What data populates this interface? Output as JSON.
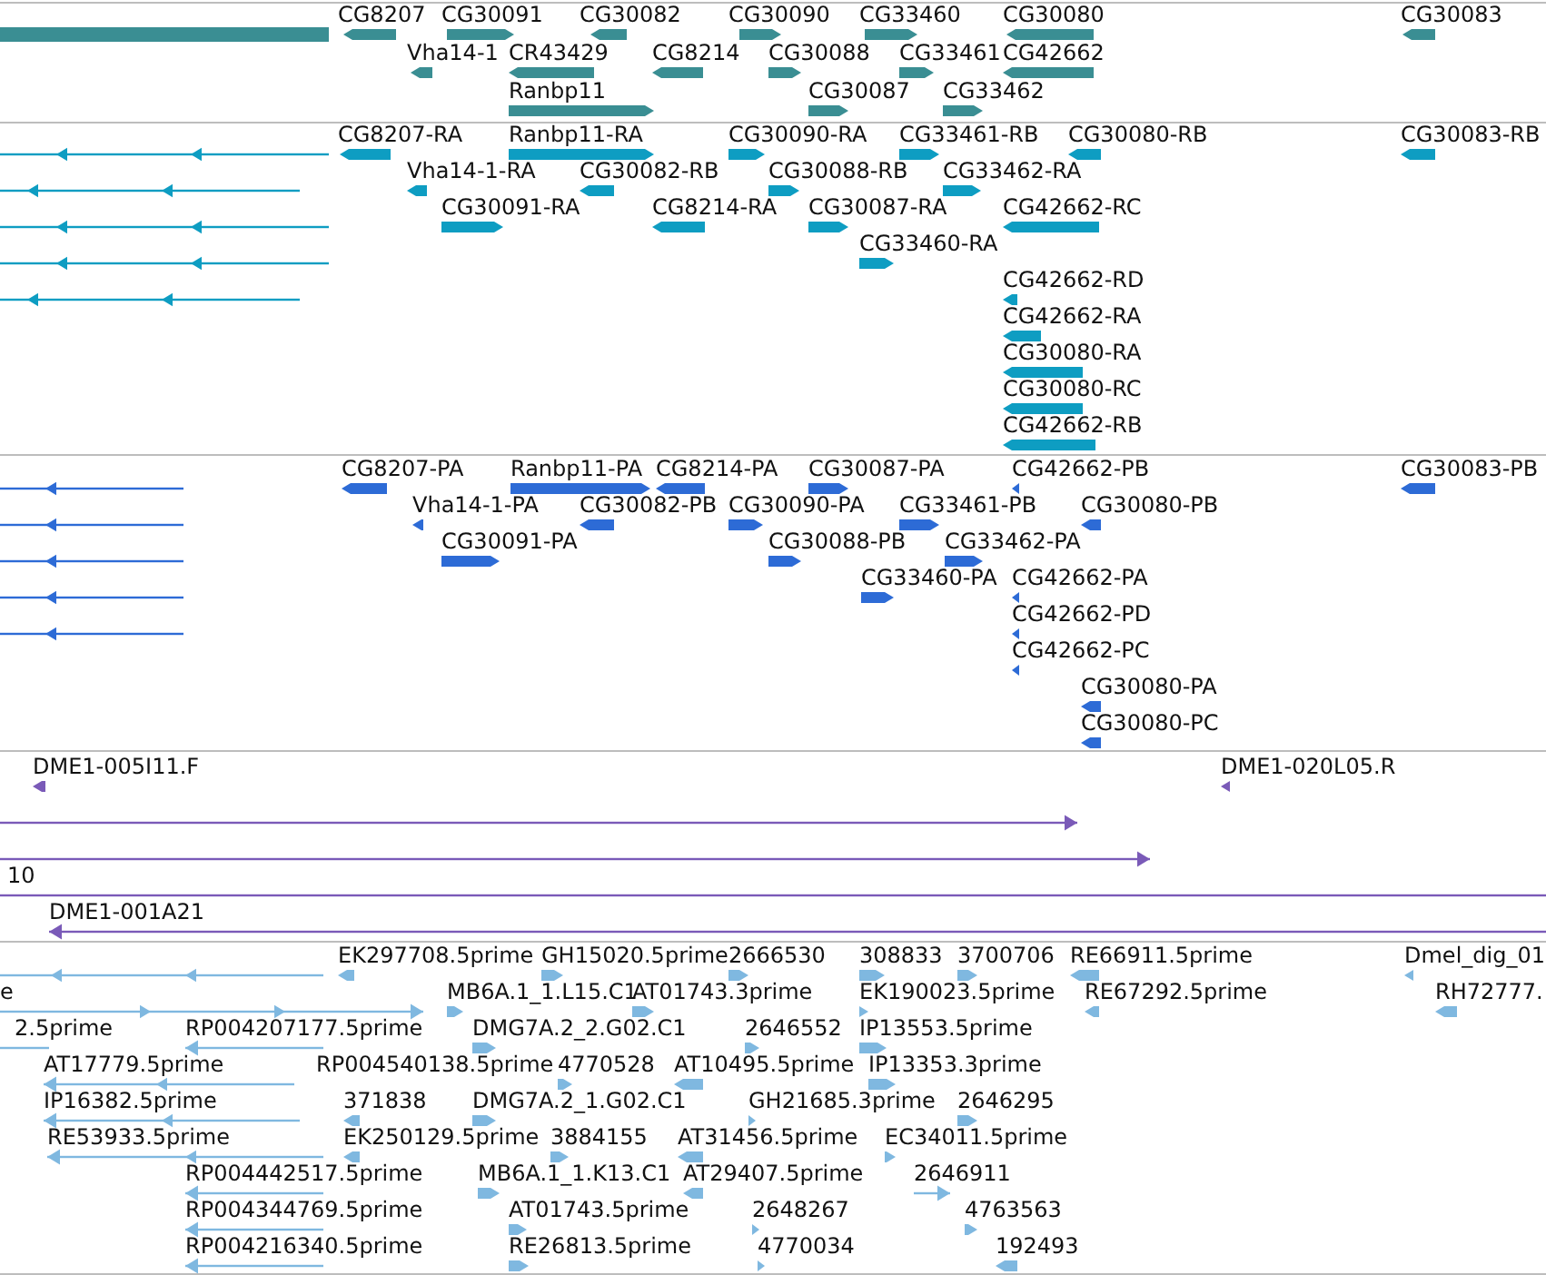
{
  "tracks": [
    {
      "color": "#3a8e93",
      "features": [
        {
          "kind": "block"
        },
        {
          "label": "CG8207",
          "reverse": true,
          "kind": "bar"
        },
        {
          "label": "CG30091",
          "reverse": false,
          "kind": "bar"
        },
        {
          "label": "CG30082",
          "reverse": true,
          "kind": "bar"
        },
        {
          "label": "CG30090",
          "reverse": false,
          "kind": "bar"
        },
        {
          "label": "CG33460",
          "reverse": false,
          "kind": "bar"
        },
        {
          "label": "CG30080",
          "reverse": true,
          "kind": "bar"
        },
        {
          "label": "CG30083",
          "reverse": true,
          "kind": "bar"
        },
        {
          "label": "Vha14-1",
          "reverse": true,
          "kind": "bar"
        },
        {
          "label": "CR43429",
          "reverse": true,
          "kind": "bar"
        },
        {
          "label": "CG8214",
          "reverse": true,
          "kind": "bar"
        },
        {
          "label": "CG30088",
          "reverse": false,
          "kind": "bar"
        },
        {
          "label": "CG33461",
          "reverse": false,
          "kind": "bar"
        },
        {
          "label": "CG42662",
          "reverse": true,
          "kind": "bar"
        },
        {
          "label": "Ranbp11",
          "reverse": false,
          "kind": "bar"
        },
        {
          "label": "CG30087",
          "reverse": false,
          "kind": "bar"
        },
        {
          "label": "CG33462",
          "reverse": false,
          "kind": "bar"
        }
      ]
    },
    {
      "color": "#0e9dc2",
      "features": [
        {
          "reverse": true,
          "kind": "line"
        },
        {
          "reverse": true,
          "kind": "line"
        },
        {
          "reverse": true,
          "kind": "line"
        },
        {
          "reverse": true,
          "kind": "line"
        },
        {
          "reverse": true,
          "kind": "line"
        },
        {
          "label": "CG8207-RA",
          "reverse": true,
          "kind": "bar"
        },
        {
          "label": "Ranbp11-RA",
          "reverse": false,
          "kind": "bar"
        },
        {
          "label": "CG30090-RA",
          "reverse": false,
          "kind": "bar"
        },
        {
          "label": "CG33461-RB",
          "reverse": false,
          "kind": "bar"
        },
        {
          "label": "CG30080-RB",
          "reverse": true,
          "kind": "bar"
        },
        {
          "label": "CG30083-RB",
          "reverse": true,
          "kind": "bar"
        },
        {
          "label": "Vha14-1-RA",
          "reverse": true,
          "kind": "bar"
        },
        {
          "label": "CG30082-RB",
          "reverse": true,
          "kind": "bar"
        },
        {
          "label": "CG30088-RB",
          "reverse": false,
          "kind": "bar"
        },
        {
          "label": "CG33462-RA",
          "reverse": false,
          "kind": "bar"
        },
        {
          "label": "CG30091-RA",
          "reverse": false,
          "kind": "bar"
        },
        {
          "label": "CG8214-RA",
          "reverse": true,
          "kind": "bar"
        },
        {
          "label": "CG30087-RA",
          "reverse": false,
          "kind": "bar"
        },
        {
          "label": "CG42662-RC",
          "reverse": true,
          "kind": "bar"
        },
        {
          "label": "CG33460-RA",
          "reverse": false,
          "kind": "bar"
        },
        {
          "label": "CG42662-RD",
          "reverse": true,
          "kind": "bar"
        },
        {
          "label": "CG42662-RA",
          "reverse": true,
          "kind": "bar"
        },
        {
          "label": "CG30080-RA",
          "reverse": true,
          "kind": "bar"
        },
        {
          "label": "CG30080-RC",
          "reverse": true,
          "kind": "bar"
        },
        {
          "label": "CG42662-RB",
          "reverse": true,
          "kind": "bar"
        }
      ]
    },
    {
      "color": "#2d6bd6",
      "features": [
        {
          "reverse": true,
          "kind": "line"
        },
        {
          "reverse": true,
          "kind": "line"
        },
        {
          "reverse": true,
          "kind": "line"
        },
        {
          "reverse": true,
          "kind": "line"
        },
        {
          "reverse": true,
          "kind": "line"
        },
        {
          "label": "CG8207-PA",
          "reverse": true,
          "kind": "bar"
        },
        {
          "label": "Ranbp11-PA",
          "reverse": false,
          "kind": "bar"
        },
        {
          "label": "CG8214-PA",
          "reverse": true,
          "kind": "bar"
        },
        {
          "label": "CG30087-PA",
          "reverse": false,
          "kind": "bar"
        },
        {
          "label": "CG42662-PB",
          "reverse": true,
          "kind": "bar"
        },
        {
          "label": "CG30083-PB",
          "reverse": true,
          "kind": "bar"
        },
        {
          "label": "Vha14-1-PA",
          "reverse": true,
          "kind": "bar"
        },
        {
          "label": "CG30082-PB",
          "reverse": true,
          "kind": "bar"
        },
        {
          "label": "CG30090-PA",
          "reverse": false,
          "kind": "bar"
        },
        {
          "label": "CG33461-PB",
          "reverse": false,
          "kind": "bar"
        },
        {
          "label": "CG30080-PB",
          "reverse": true,
          "kind": "bar"
        },
        {
          "label": "CG30091-PA",
          "reverse": false,
          "kind": "bar"
        },
        {
          "label": "CG30088-PB",
          "reverse": false,
          "kind": "bar"
        },
        {
          "label": "CG33462-PA",
          "reverse": false,
          "kind": "bar"
        },
        {
          "label": "CG33460-PA",
          "reverse": false,
          "kind": "bar"
        },
        {
          "label": "CG42662-PA",
          "reverse": true,
          "kind": "bar"
        },
        {
          "label": "CG42662-PD",
          "reverse": true,
          "kind": "bar"
        },
        {
          "label": "CG42662-PC",
          "reverse": true,
          "kind": "bar"
        },
        {
          "label": "CG30080-PA",
          "reverse": true,
          "kind": "bar"
        },
        {
          "label": "CG30080-PC",
          "reverse": true,
          "kind": "bar"
        }
      ]
    },
    {
      "color": "#7a5ab8",
      "features": [
        {
          "label": "DME1-005I11.F",
          "reverse": true,
          "kind": "bar"
        },
        {
          "label": "DME1-020L05.R",
          "reverse": true,
          "kind": "bar"
        },
        {
          "reverse": false,
          "kind": "line"
        },
        {
          "reverse": false,
          "kind": "line"
        },
        {
          "label": "10",
          "kind": "line"
        },
        {
          "label": "DME1-001A21",
          "reverse": true,
          "kind": "line"
        }
      ]
    },
    {
      "color": "#7fb8e0",
      "features": [
        {
          "reverse": true,
          "kind": "line"
        },
        {
          "label": "EK297708.5prime",
          "reverse": true,
          "kind": "bar"
        },
        {
          "label": "GH15020.5prime",
          "reverse": false,
          "kind": "bar"
        },
        {
          "label": "2666530",
          "reverse": false,
          "kind": "bar"
        },
        {
          "label": "308833",
          "reverse": false,
          "kind": "bar"
        },
        {
          "label": "3700706",
          "reverse": false,
          "kind": "bar"
        },
        {
          "label": "RE66911.5prime",
          "reverse": true,
          "kind": "bar"
        },
        {
          "label": "Dmel_dig_01",
          "reverse": true,
          "kind": "bar"
        },
        {
          "label": "e",
          "reverse": false,
          "kind": "line"
        },
        {
          "label": "MB6A.1_1.L15.C1",
          "reverse": false,
          "kind": "bar"
        },
        {
          "label": "AT01743.3prime",
          "reverse": false,
          "kind": "bar"
        },
        {
          "label": "EK190023.5prime",
          "reverse": false,
          "kind": "bar"
        },
        {
          "label": "RE67292.5prime",
          "reverse": true,
          "kind": "bar"
        },
        {
          "label": "RH72777.",
          "reverse": true,
          "kind": "bar"
        },
        {
          "label": "2.5prime",
          "reverse": true,
          "kind": "line"
        },
        {
          "label": "RP004207177.5prime",
          "reverse": true,
          "kind": "line"
        },
        {
          "label": "DMG7A.2_2.G02.C1",
          "reverse": false,
          "kind": "bar"
        },
        {
          "label": "2646552",
          "reverse": false,
          "kind": "bar"
        },
        {
          "label": "IP13553.5prime",
          "reverse": false,
          "kind": "bar"
        },
        {
          "label": "AT17779.5prime",
          "reverse": true,
          "kind": "line"
        },
        {
          "label": "RP004540138.5prime"
        },
        {
          "label": "4770528",
          "reverse": false,
          "kind": "bar"
        },
        {
          "label": "AT10495.5prime",
          "reverse": true,
          "kind": "bar"
        },
        {
          "label": "IP13353.3prime",
          "reverse": false,
          "kind": "bar"
        },
        {
          "label": "IP16382.5prime",
          "reverse": true,
          "kind": "line"
        },
        {
          "label": "371838",
          "reverse": true,
          "kind": "bar"
        },
        {
          "label": "DMG7A.2_1.G02.C1",
          "reverse": false,
          "kind": "bar"
        },
        {
          "label": "GH21685.3prime",
          "reverse": false,
          "kind": "bar"
        },
        {
          "label": "2646295",
          "reverse": false,
          "kind": "bar"
        },
        {
          "label": "RE53933.5prime",
          "reverse": true,
          "kind": "line"
        },
        {
          "label": "EK250129.5prime",
          "reverse": true,
          "kind": "bar"
        },
        {
          "label": "3884155",
          "reverse": false,
          "kind": "bar"
        },
        {
          "label": "AT31456.5prime",
          "reverse": true,
          "kind": "bar"
        },
        {
          "label": "EC34011.5prime",
          "reverse": false,
          "kind": "bar"
        },
        {
          "label": "RP004442517.5prime",
          "reverse": true,
          "kind": "line"
        },
        {
          "label": "MB6A.1_1.K13.C1",
          "reverse": false,
          "kind": "bar"
        },
        {
          "label": "AT29407.5prime",
          "reverse": true,
          "kind": "bar"
        },
        {
          "label": "2646911",
          "reverse": false,
          "kind": "line"
        },
        {
          "label": "RP004344769.5prime",
          "reverse": true,
          "kind": "line"
        },
        {
          "label": "AT01743.5prime",
          "reverse": false,
          "kind": "bar"
        },
        {
          "label": "2648267",
          "reverse": false,
          "kind": "bar"
        },
        {
          "label": "4763563",
          "reverse": false,
          "kind": "bar"
        },
        {
          "label": "RP004216340.5prime",
          "reverse": true,
          "kind": "line"
        },
        {
          "label": "RE26813.5prime",
          "reverse": false,
          "kind": "bar"
        },
        {
          "label": "4770034",
          "reverse": false,
          "kind": "bar"
        },
        {
          "label": "192493",
          "reverse": true,
          "kind": "bar"
        }
      ]
    }
  ]
}
